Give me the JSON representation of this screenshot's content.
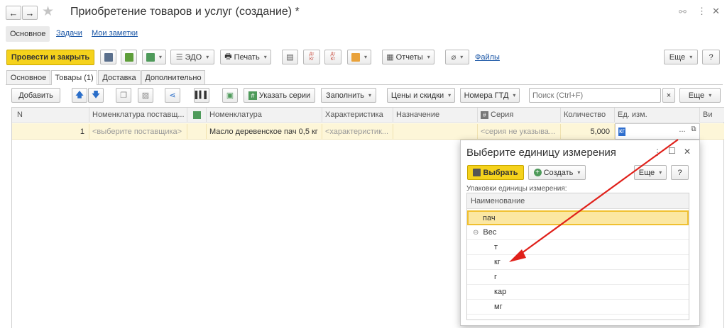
{
  "header": {
    "title": "Приобретение товаров и услуг (создание) *"
  },
  "nav": {
    "main": "Основное",
    "tasks": "Задачи",
    "notes": "Мои заметки"
  },
  "toolbar": {
    "post_close": "Провести и закрыть",
    "edo": "ЭДО",
    "print": "Печать",
    "dt": "Дт",
    "kt": "Кт",
    "reports": "Отчеты",
    "files": "Файлы",
    "more": "Еще",
    "help": "?"
  },
  "tabs": [
    "Основное",
    "Товары (1)",
    "Доставка",
    "Дополнительно"
  ],
  "table_toolbar": {
    "add": "Добавить",
    "specify_series": "Указать серии",
    "fill": "Заполнить",
    "prices": "Цены и скидки",
    "gtd": "Номера ГТД",
    "search_placeholder": "Поиск (Ctrl+F)",
    "clear": "×",
    "more": "Еще"
  },
  "table": {
    "headers": [
      "N",
      "Номенклатура поставщ...",
      "Номенклатура",
      "Характеристика",
      "Назначение",
      "Серия",
      "Количество",
      "Ед. изм.",
      "Ви"
    ],
    "row": {
      "n": "1",
      "supplier_item": "<выберите поставщика>",
      "item": "Масло деревенское пач 0,5 кг",
      "characteristic": "<характеристик...",
      "purpose": "",
      "series": "<серия не указыва...",
      "quantity": "5,000",
      "unit": "кг",
      "unit_btn": "...",
      "open_btn": "⧉"
    }
  },
  "dialog": {
    "title": "Выберите единицу измерения",
    "select": "Выбрать",
    "create": "Создать",
    "more": "Еще",
    "help": "?",
    "subtitle": "Упаковки единицы измерения:",
    "column": "Наименование",
    "items": [
      {
        "label": "пач",
        "selected": true
      },
      {
        "label": "Вес",
        "group": true
      },
      {
        "label": "т"
      },
      {
        "label": "кг"
      },
      {
        "label": "г"
      },
      {
        "label": "кар"
      },
      {
        "label": "мг"
      }
    ]
  },
  "colors": {
    "accent_yellow": "#f5d21c",
    "row_highlight": "#fdf6d8",
    "link": "#1a56a6",
    "arrow": "#e0201a"
  }
}
